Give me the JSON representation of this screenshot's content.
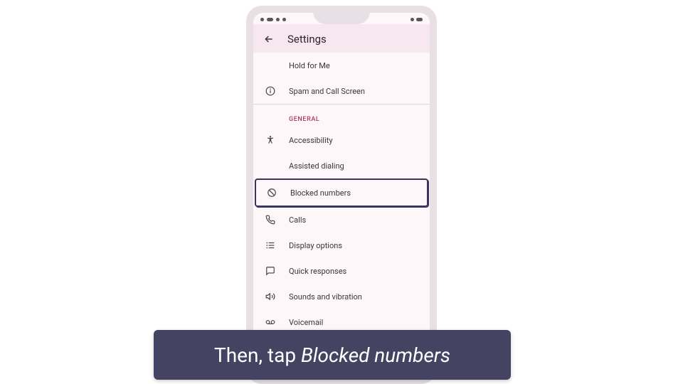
{
  "header": {
    "title": "Settings"
  },
  "top_section": {
    "items": [
      {
        "label": "Hold for Me",
        "icon": ""
      },
      {
        "label": "Spam and Call Screen",
        "icon": "info"
      }
    ]
  },
  "general_section": {
    "title": "GENERAL",
    "items": [
      {
        "label": "Accessibility",
        "icon": "accessibility"
      },
      {
        "label": "Assisted dialing",
        "icon": ""
      },
      {
        "label": "Blocked numbers",
        "icon": "block",
        "highlighted": true
      },
      {
        "label": "Calls",
        "icon": "phone"
      },
      {
        "label": "Display options",
        "icon": "list"
      },
      {
        "label": "Quick responses",
        "icon": "message"
      },
      {
        "label": "Sounds and vibration",
        "icon": "volume"
      },
      {
        "label": "Voicemail",
        "icon": "voicemail"
      }
    ]
  },
  "caption": {
    "prefix": "Then, tap ",
    "emphasis": "Blocked numbers"
  }
}
